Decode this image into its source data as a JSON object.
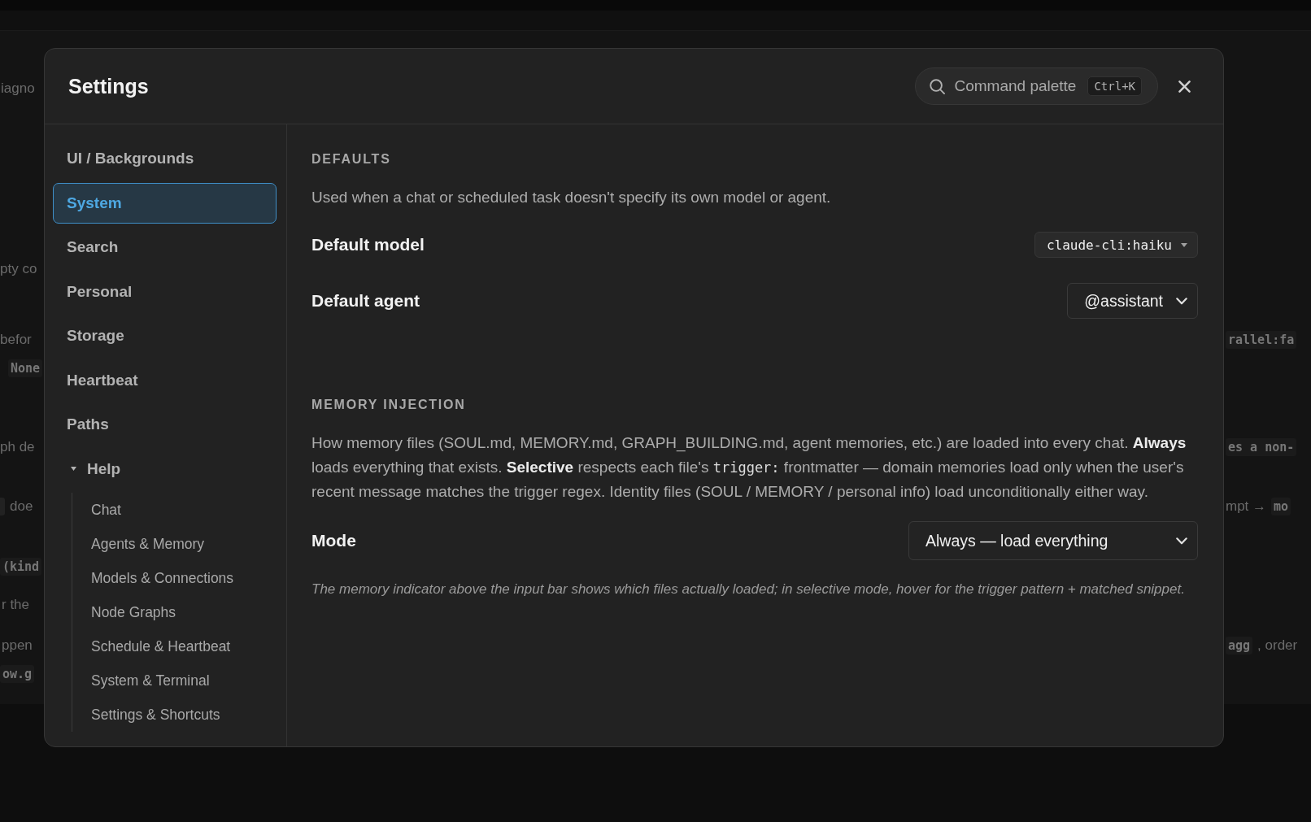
{
  "background_page": {
    "lines": [
      {
        "left": [
          {
            "kind": "text",
            "text": "iagno"
          }
        ]
      },
      {
        "left": [
          {
            "kind": "text",
            "text": "pty co"
          }
        ]
      },
      {
        "left": [
          {
            "kind": "text",
            "text": "befor"
          }
        ],
        "right": [
          {
            "kind": "code",
            "text": "rallel:fa"
          }
        ]
      },
      {
        "left": [
          {
            "kind": "code",
            "text": "None"
          }
        ]
      },
      {
        "left": [
          {
            "kind": "text",
            "text": "ph de"
          }
        ],
        "right": [
          {
            "kind": "code",
            "text": "es a non-"
          }
        ]
      },
      {
        "left": [
          {
            "kind": "chip"
          },
          {
            "kind": "text",
            "text": "doe"
          }
        ],
        "right": [
          {
            "kind": "text",
            "text": "mpt →"
          },
          {
            "kind": "code",
            "text": "mo"
          }
        ]
      },
      {
        "left": [
          {
            "kind": "code",
            "text": "(kind"
          }
        ]
      },
      {
        "left": [
          {
            "kind": "text",
            "text": "r the"
          }
        ]
      },
      {
        "left": [
          {
            "kind": "text",
            "text": "ppen"
          }
        ],
        "right": [
          {
            "kind": "code",
            "text": "agg"
          },
          {
            "kind": "text",
            "text": ", order"
          }
        ]
      },
      {
        "left": [
          {
            "kind": "code",
            "text": "ow.g"
          }
        ]
      }
    ]
  },
  "window": {
    "title": "Settings"
  },
  "command_palette": {
    "label": "Command palette",
    "shortcut": "Ctrl+K"
  },
  "sidebar": {
    "items": [
      {
        "label": "UI / Backgrounds",
        "selected": false
      },
      {
        "label": "System",
        "selected": true
      },
      {
        "label": "Search",
        "selected": false
      },
      {
        "label": "Personal",
        "selected": false
      },
      {
        "label": "Storage",
        "selected": false
      },
      {
        "label": "Heartbeat",
        "selected": false
      },
      {
        "label": "Paths",
        "selected": false
      },
      {
        "label": "Help",
        "selected": false,
        "expanded": true,
        "children": [
          {
            "label": "Chat",
            "selected": false
          },
          {
            "label": "Agents & Memory",
            "selected": false
          },
          {
            "label": "Models & Connections",
            "selected": false
          },
          {
            "label": "Node Graphs",
            "selected": false
          },
          {
            "label": "Schedule & Heartbeat",
            "selected": false
          },
          {
            "label": "System & Terminal",
            "selected": false
          },
          {
            "label": "Settings & Shortcuts",
            "selected": false
          }
        ]
      }
    ]
  },
  "content": {
    "sections": [
      {
        "heading": "DEFAULTS",
        "description": [
          {
            "kind": "text",
            "text": "Used when a chat or scheduled task doesn't specify its own model or agent."
          }
        ],
        "fields": [
          {
            "label": "Default model",
            "kind": "compact",
            "value": "claude-cli:haiku"
          },
          {
            "label": "Default agent",
            "kind": "standard",
            "value": "@assistant"
          }
        ]
      },
      {
        "heading": "MEMORY INJECTION",
        "description": [
          {
            "kind": "text",
            "text": "How memory files (SOUL.md, MEMORY.md, GRAPH_BUILDING.md, agent memories, etc.) are loaded into every chat. **Always** loads everything that exists. **Selective** respects each file's "
          },
          {
            "kind": "code",
            "text": "trigger:"
          },
          {
            "kind": "text",
            "text": " frontmatter — domain memories load only when the user's recent message matches the trigger regex. Identity files (SOUL / MEMORY / personal info) load unconditionally either way."
          }
        ],
        "fields": [
          {
            "label": "Mode",
            "kind": "wide",
            "value": "Always — load everything"
          }
        ],
        "note": "The memory indicator above the input bar shows which files actually loaded; in selective mode, hover for the trigger pattern + matched snippet."
      }
    ]
  }
}
